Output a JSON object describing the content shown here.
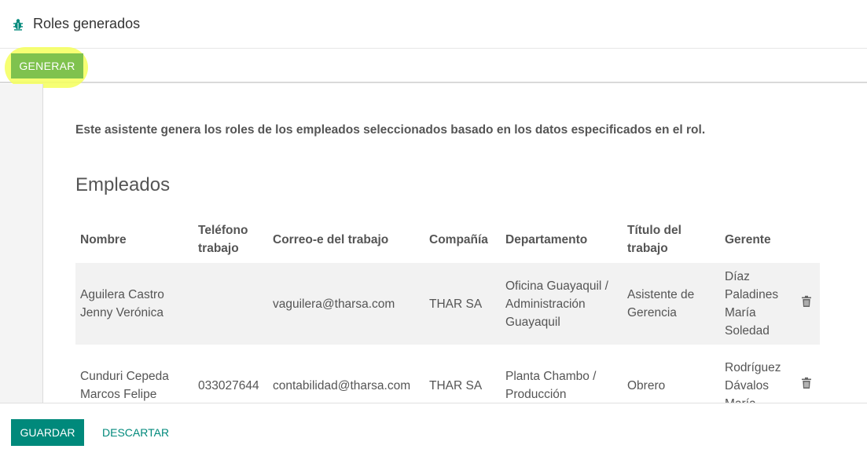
{
  "header": {
    "title": "Roles generados",
    "icon": "bug-icon"
  },
  "toolbar": {
    "generate_label": "GENERAR"
  },
  "main": {
    "description": "Este asistente genera los roles de los empleados seleccionados basado en los datos especificados en el rol.",
    "section_title": "Empleados",
    "columns": [
      "Nombre",
      "Teléfono trabajo",
      "Correo-e del trabajo",
      "Compañía",
      "Departamento",
      "Título del trabajo",
      "Gerente"
    ],
    "rows": [
      {
        "name": "Aguilera Castro Jenny Verónica",
        "phone": "",
        "email": "vaguilera@tharsa.com",
        "company": "THAR SA",
        "department": "Oficina Guayaquil / Administración Guayaquil",
        "job_title": "Asistente de Gerencia",
        "manager": "Díaz Paladines María Soledad"
      },
      {
        "name": "Cunduri Cepeda Marcos Felipe",
        "phone": "033027644",
        "email": "contabilidad@tharsa.com",
        "company": "THAR SA",
        "department": "Planta Chambo / Producción",
        "job_title": "Obrero",
        "manager": "Rodríguez Dávalos María"
      }
    ]
  },
  "footer": {
    "save_label": "GUARDAR",
    "discard_label": "DESCARTAR"
  },
  "colors": {
    "accent": "#00897b",
    "generate": "#7fc24e",
    "highlight": "#f4ff5a"
  }
}
